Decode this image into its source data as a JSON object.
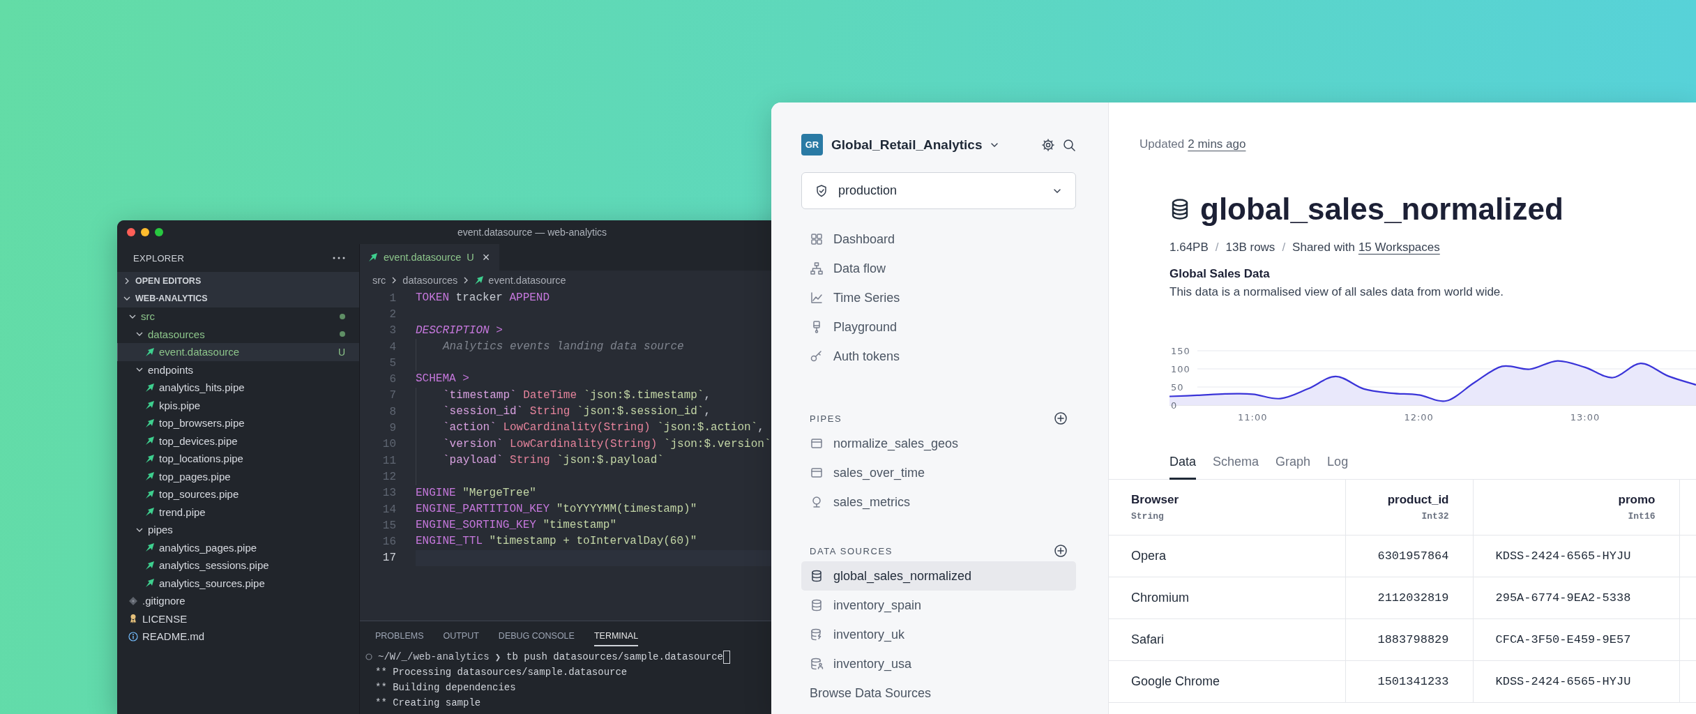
{
  "vscode": {
    "title": "event.datasource — web-analytics",
    "explorer": {
      "title": "EXPLORER",
      "sections": [
        {
          "label": "OPEN EDITORS",
          "expanded": false
        },
        {
          "label": "WEB-ANALYTICS",
          "expanded": true,
          "tree": [
            {
              "name": "src",
              "kind": "folder",
              "expanded": true,
              "modified": true,
              "selected": false,
              "children": [
                {
                  "name": "datasources",
                  "kind": "folder",
                  "expanded": true,
                  "modified": true,
                  "selected": false,
                  "children": [
                    {
                      "name": "event.datasource",
                      "kind": "tinybird",
                      "modified": true,
                      "badge": "U",
                      "selected": true
                    }
                  ]
                },
                {
                  "name": "endpoints",
                  "kind": "folder",
                  "expanded": true,
                  "modified": false,
                  "selected": false,
                  "children": [
                    {
                      "name": "analytics_hits.pipe",
                      "kind": "tinybird",
                      "modified": false,
                      "selected": false
                    },
                    {
                      "name": "kpis.pipe",
                      "kind": "tinybird",
                      "modified": false,
                      "selected": false
                    },
                    {
                      "name": "top_browsers.pipe",
                      "kind": "tinybird",
                      "modified": false,
                      "selected": false
                    },
                    {
                      "name": "top_devices.pipe",
                      "kind": "tinybird",
                      "modified": false,
                      "selected": false
                    },
                    {
                      "name": "top_locations.pipe",
                      "kind": "tinybird",
                      "modified": false,
                      "selected": false
                    },
                    {
                      "name": "top_pages.pipe",
                      "kind": "tinybird",
                      "modified": false,
                      "selected": false
                    },
                    {
                      "name": "top_sources.pipe",
                      "kind": "tinybird",
                      "modified": false,
                      "selected": false
                    },
                    {
                      "name": "trend.pipe",
                      "kind": "tinybird",
                      "modified": false,
                      "selected": false
                    }
                  ]
                },
                {
                  "name": "pipes",
                  "kind": "folder",
                  "expanded": true,
                  "modified": false,
                  "selected": false,
                  "children": [
                    {
                      "name": "analytics_pages.pipe",
                      "kind": "tinybird",
                      "modified": false,
                      "selected": false
                    },
                    {
                      "name": "analytics_sessions.pipe",
                      "kind": "tinybird",
                      "modified": false,
                      "selected": false
                    },
                    {
                      "name": "analytics_sources.pipe",
                      "kind": "tinybird",
                      "modified": false,
                      "selected": false
                    }
                  ]
                }
              ]
            },
            {
              "name": ".gitignore",
              "kind": "git",
              "modified": false,
              "selected": false
            },
            {
              "name": "LICENSE",
              "kind": "license",
              "modified": false,
              "selected": false
            },
            {
              "name": "README.md",
              "kind": "info",
              "modified": false,
              "selected": false
            }
          ]
        }
      ]
    },
    "editor": {
      "tabs": [
        {
          "label": "event.datasource",
          "badge": "U",
          "close": "×",
          "selected": true
        }
      ],
      "breadcrumb": [
        "src",
        "datasources",
        "event.datasource"
      ],
      "lines": [
        {
          "n": "1",
          "current": false,
          "indented": false,
          "tokens": [
            {
              "kind": "keyword",
              "text": "TOKEN"
            },
            {
              "kind": "text",
              "text": " tracker "
            },
            {
              "kind": "keyword",
              "text": "APPEND"
            }
          ]
        },
        {
          "n": "2",
          "current": false,
          "indented": false
        },
        {
          "n": "3",
          "current": false,
          "indented": false,
          "tokens": [
            {
              "kind": "keyword-italic",
              "text": "DESCRIPTION"
            },
            {
              "kind": "keyword",
              "text": " >"
            }
          ]
        },
        {
          "n": "4",
          "current": false,
          "indented": true,
          "tokens": [
            {
              "kind": "comment",
              "text": "Analytics events landing data source"
            }
          ]
        },
        {
          "n": "5",
          "current": false,
          "indented": true
        },
        {
          "n": "6",
          "current": false,
          "indented": false,
          "tokens": [
            {
              "kind": "keyword",
              "text": "SCHEMA >"
            }
          ]
        },
        {
          "n": "7",
          "current": false,
          "indented": true,
          "tokens": [
            {
              "kind": "field",
              "text": "`timestamp`"
            },
            {
              "kind": "type",
              "text": " DateTime "
            },
            {
              "kind": "string",
              "text": "`json:$.timestamp`"
            },
            {
              "kind": "text",
              "text": ","
            }
          ]
        },
        {
          "n": "8",
          "current": false,
          "indented": true,
          "tokens": [
            {
              "kind": "field",
              "text": "`session_id`"
            },
            {
              "kind": "type",
              "text": " String "
            },
            {
              "kind": "string",
              "text": "`json:$.session_id`"
            },
            {
              "kind": "text",
              "text": ","
            }
          ]
        },
        {
          "n": "9",
          "current": false,
          "indented": true,
          "tokens": [
            {
              "kind": "field",
              "text": "`action`"
            },
            {
              "kind": "type",
              "text": " LowCardinality(String) "
            },
            {
              "kind": "string",
              "text": "`json:$.action`"
            },
            {
              "kind": "text",
              "text": ","
            }
          ]
        },
        {
          "n": "10",
          "current": false,
          "indented": true,
          "tokens": [
            {
              "kind": "field",
              "text": "`version`"
            },
            {
              "kind": "type",
              "text": " LowCardinality(String) "
            },
            {
              "kind": "string",
              "text": "`json:$.version`"
            }
          ]
        },
        {
          "n": "11",
          "current": false,
          "indented": true,
          "tokens": [
            {
              "kind": "field",
              "text": "`payload`"
            },
            {
              "kind": "type",
              "text": " String "
            },
            {
              "kind": "string",
              "text": "`json:$.payload`"
            }
          ]
        },
        {
          "n": "12",
          "current": false,
          "indented": true
        },
        {
          "n": "13",
          "current": false,
          "indented": false,
          "tokens": [
            {
              "kind": "keyword",
              "text": "ENGINE"
            },
            {
              "kind": "string",
              "text": " \"MergeTree\""
            }
          ]
        },
        {
          "n": "14",
          "current": false,
          "indented": false,
          "tokens": [
            {
              "kind": "keyword",
              "text": "ENGINE_PARTITION_KEY"
            },
            {
              "kind": "string",
              "text": " \"toYYYYMM(timestamp)\""
            }
          ]
        },
        {
          "n": "15",
          "current": false,
          "indented": false,
          "tokens": [
            {
              "kind": "keyword",
              "text": "ENGINE_SORTING_KEY"
            },
            {
              "kind": "string",
              "text": " \"timestamp\""
            }
          ]
        },
        {
          "n": "16",
          "current": false,
          "indented": false,
          "tokens": [
            {
              "kind": "keyword",
              "text": "ENGINE_TTL"
            },
            {
              "kind": "string",
              "text": " \"timestamp + toIntervalDay(60)\""
            }
          ]
        },
        {
          "n": "17",
          "current": true,
          "indented": false
        }
      ]
    },
    "terminal": {
      "tabs": [
        {
          "label": "PROBLEMS",
          "selected": false
        },
        {
          "label": "OUTPUT",
          "selected": false
        },
        {
          "label": "DEBUG CONSOLE",
          "selected": false
        },
        {
          "label": "TERMINAL",
          "selected": true
        }
      ],
      "prompt_path": "~/W/_/web-analytics",
      "prompt_symbol": "❯",
      "command": "tb push datasources/sample.datasource",
      "output": [
        "** Processing datasources/sample.datasource",
        "** Building dependencies",
        "** Creating sample"
      ]
    }
  },
  "tinybird": {
    "sidebar": {
      "workspace": {
        "initials": "GR",
        "name": "Global_Retail_Analytics"
      },
      "environment": "production",
      "nav": [
        {
          "label": "Dashboard",
          "kind": "grid",
          "selected": false
        },
        {
          "label": "Data flow",
          "kind": "flow",
          "selected": false
        },
        {
          "label": "Time Series",
          "kind": "series",
          "selected": false
        },
        {
          "label": "Playground",
          "kind": "playground",
          "selected": false
        },
        {
          "label": "Auth tokens",
          "kind": "key",
          "selected": false
        }
      ],
      "sections": [
        {
          "title": "PIPES",
          "items": [
            {
              "label": "normalize_sales_geos",
              "kind": "pipe",
              "selected": false
            },
            {
              "label": "sales_over_time",
              "kind": "pipe",
              "selected": false
            },
            {
              "label": "sales_metrics",
              "kind": "endpoint",
              "selected": false
            }
          ]
        },
        {
          "title": "DATA SOURCES",
          "items": [
            {
              "label": "global_sales_normalized",
              "kind": "database",
              "selected": true
            },
            {
              "label": "inventory_spain",
              "kind": "database",
              "selected": false
            },
            {
              "label": "inventory_uk",
              "kind": "database-bolt",
              "selected": false
            },
            {
              "label": "inventory_usa",
              "kind": "database-user",
              "selected": false
            },
            {
              "label": "Browse Data Sources",
              "kind": "link",
              "selected": false
            }
          ]
        }
      ]
    },
    "main": {
      "updated_prefix": "Updated",
      "updated_link": "2 mins ago",
      "title": "global_sales_normalized",
      "meta": [
        {
          "kind": "text",
          "text": "1.64PB"
        },
        {
          "kind": "separator",
          "text": "/"
        },
        {
          "kind": "text",
          "text": "13B rows"
        },
        {
          "kind": "separator",
          "text": "/"
        },
        {
          "kind": "text",
          "text": "Shared with"
        },
        {
          "kind": "link",
          "text": "15 Workspaces"
        }
      ],
      "description_title": "Global Sales Data",
      "description": "This data is a normalised view of all sales data from world wide.",
      "chart_data": {
        "type": "area",
        "categories": [
          null,
          null,
          null,
          "11:00",
          null,
          null,
          null,
          null,
          null,
          "12:00",
          null,
          null,
          null,
          null,
          null,
          "13:00",
          null,
          null,
          null,
          null
        ],
        "values": [
          24,
          27,
          31,
          30,
          18,
          45,
          79,
          45,
          33,
          28,
          12,
          62,
          107,
          99,
          122,
          104,
          76,
          115,
          80,
          56
        ],
        "ylim": [
          0,
          150
        ],
        "yticks": [
          0,
          50,
          100,
          150
        ]
      },
      "tabs": [
        {
          "label": "Data",
          "selected": true
        },
        {
          "label": "Schema",
          "selected": false
        },
        {
          "label": "Graph",
          "selected": false
        },
        {
          "label": "Log",
          "selected": false
        }
      ],
      "table": {
        "columns": [
          {
            "name": "Browser",
            "type": "String",
            "kind": "text"
          },
          {
            "name": "product_id",
            "type": "Int32",
            "kind": "number"
          },
          {
            "name": "promo",
            "type": "Int16",
            "kind": "code"
          }
        ],
        "rows": [
          [
            "Opera",
            "6301957864",
            "KDSS-2424-6565-HYJU"
          ],
          [
            "Chromium",
            "2112032819",
            "295A-6774-9EA2-5338"
          ],
          [
            "Safari",
            "1883798829",
            "CFCA-3F50-E459-9E57"
          ],
          [
            "Google Chrome",
            "1501341233",
            "KDSS-2424-6565-HYJU"
          ]
        ]
      }
    }
  }
}
